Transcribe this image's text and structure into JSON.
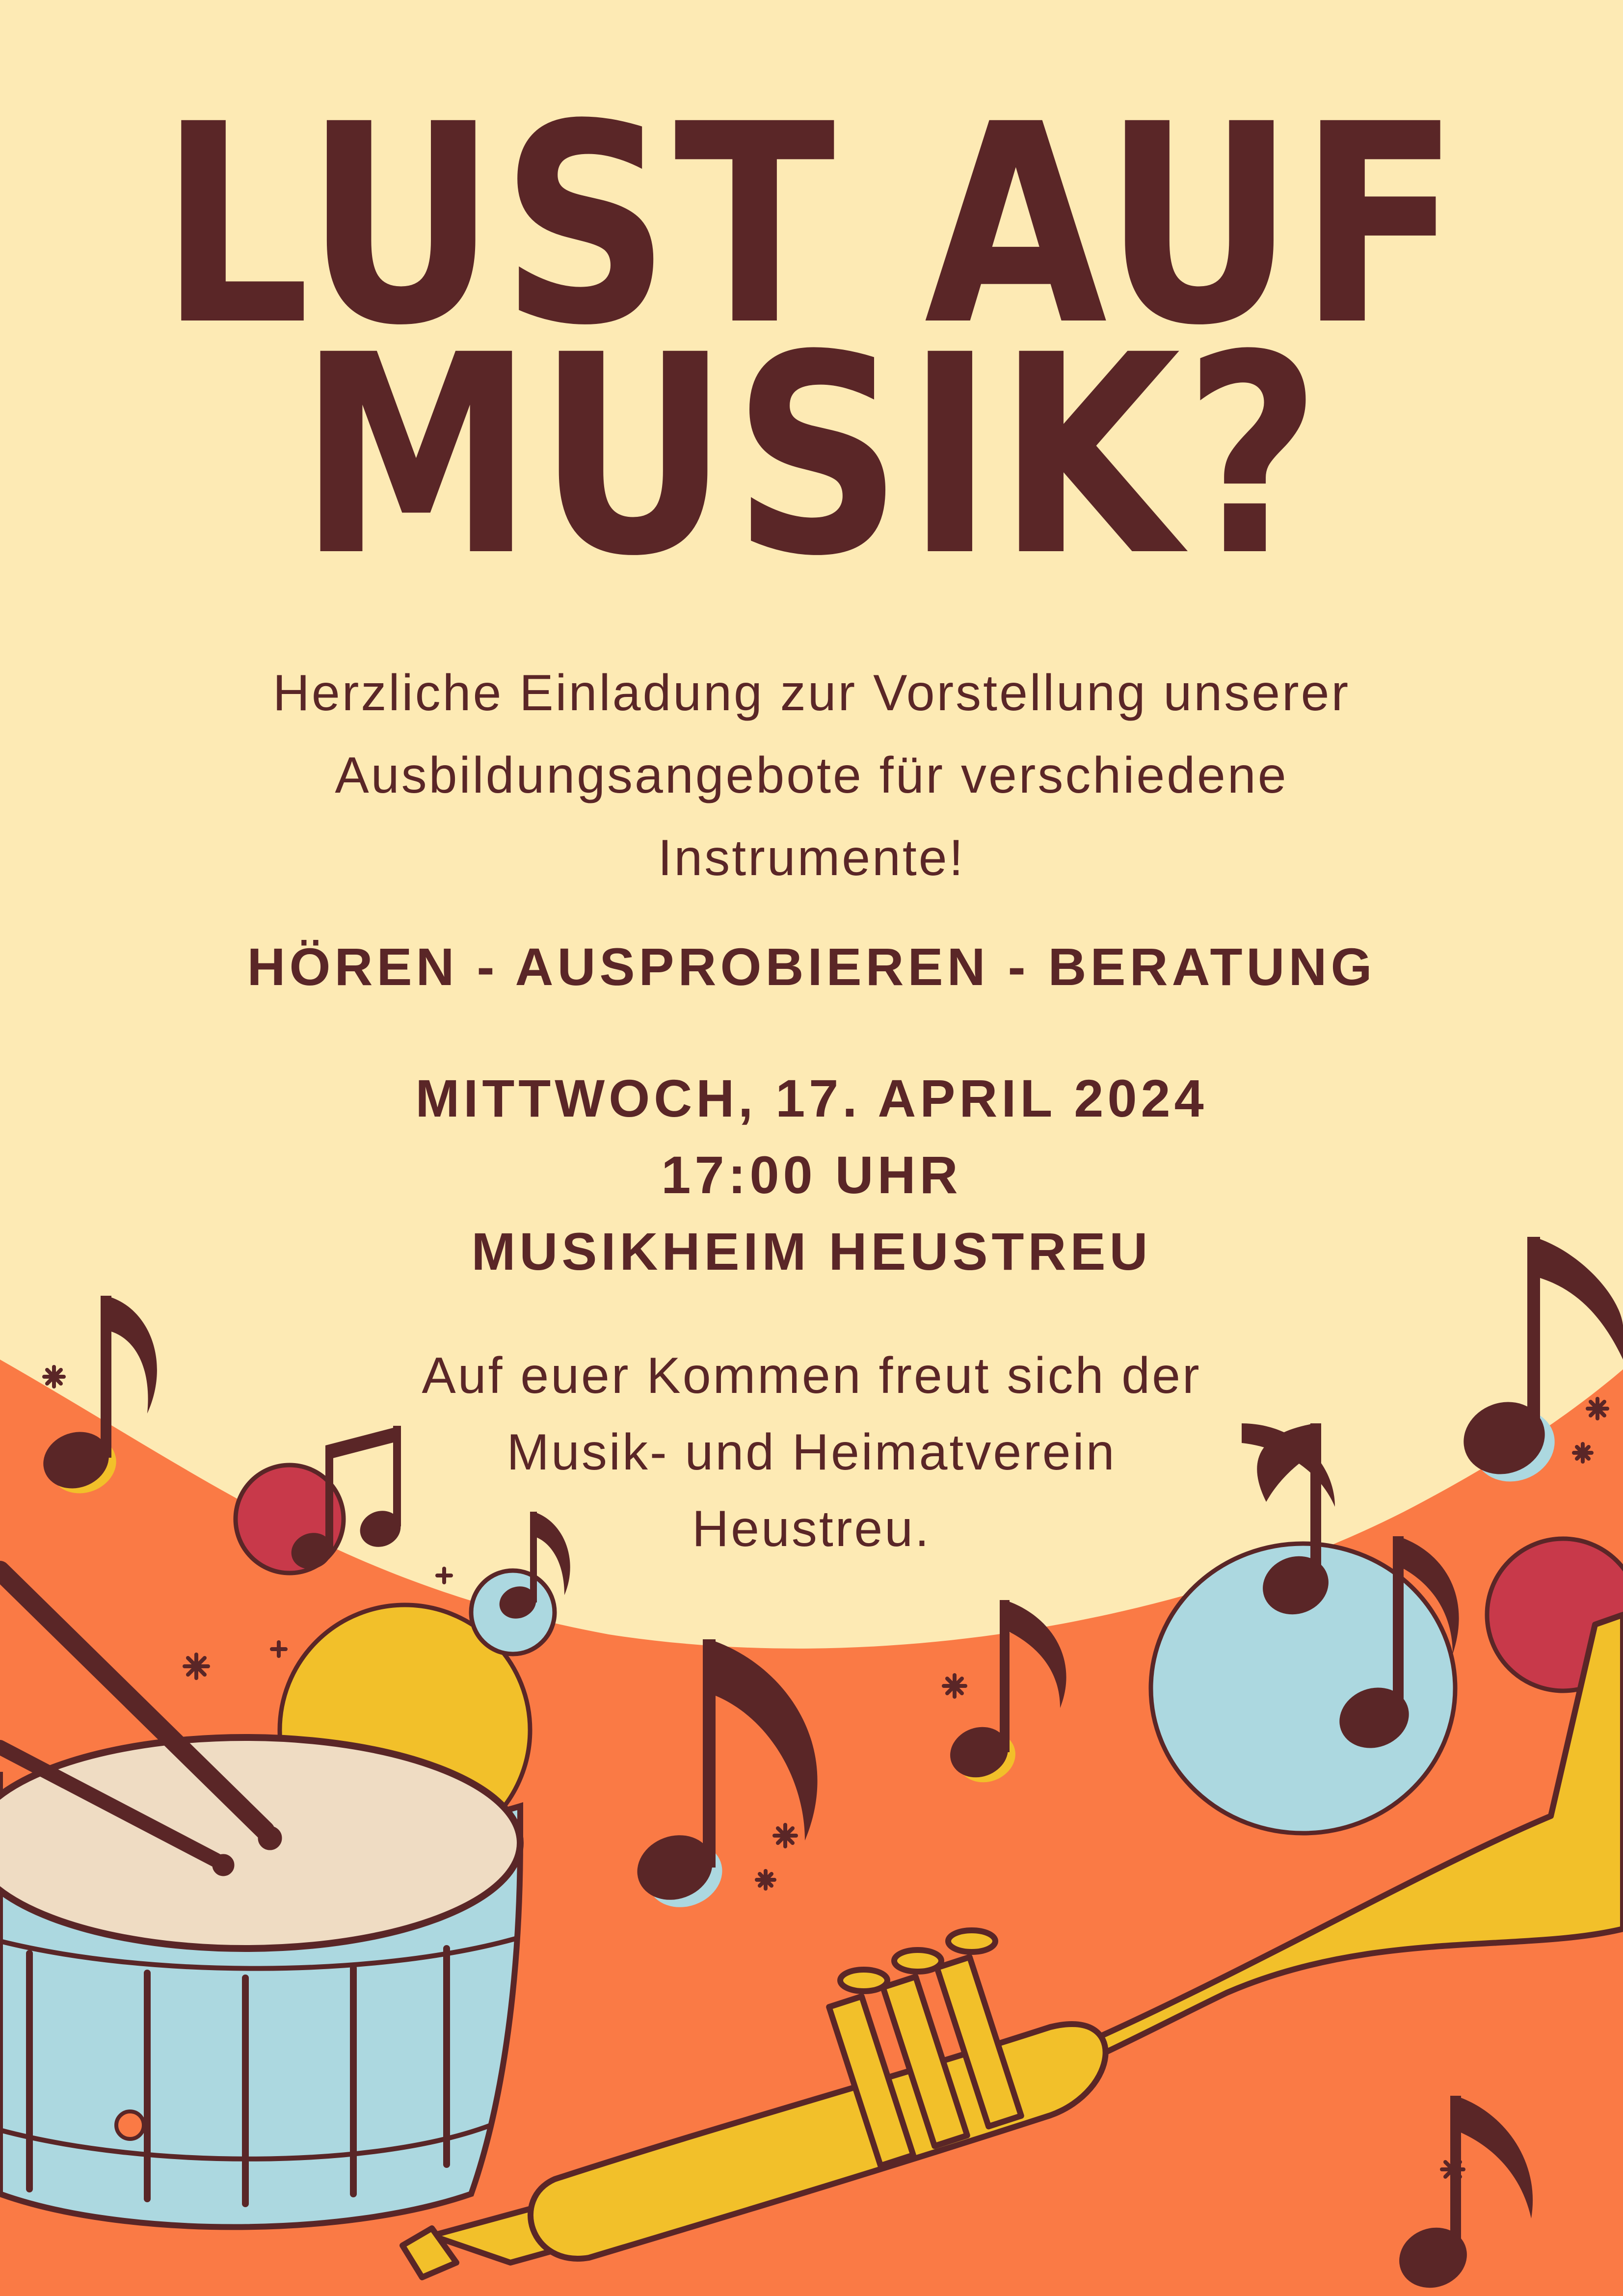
{
  "headline": {
    "line1": "LUST AUF",
    "line2": "MUSIK?"
  },
  "invitation": {
    "lines": [
      "Herzliche Einladung zur Vorstellung unserer",
      "Ausbildungsangebote für verschiedene",
      "Instrumente!"
    ]
  },
  "tagline": "HÖREN - AUSPROBIEREN - BERATUNG",
  "event": {
    "date": "MITTWOCH, 17. APRIL 2024",
    "time": "17:00 UHR",
    "location": "MUSIKHEIM HEUSTREU"
  },
  "closing": {
    "lines": [
      "Auf euer Kommen freut sich der",
      "Musik- und Heimatverein",
      "Heustreu."
    ]
  },
  "colors": {
    "background": "#fdeab4",
    "text": "#5a2627",
    "orange": "#fa7a45",
    "yellow": "#f2c02a",
    "light-blue": "#acd8e0",
    "red": "#c8394a",
    "drum-head": "#efdcc3"
  },
  "illustration": {
    "icons": [
      "music-note-icon",
      "drum-icon",
      "drumstick-icon",
      "trumpet-icon",
      "sparkle-icon"
    ]
  }
}
